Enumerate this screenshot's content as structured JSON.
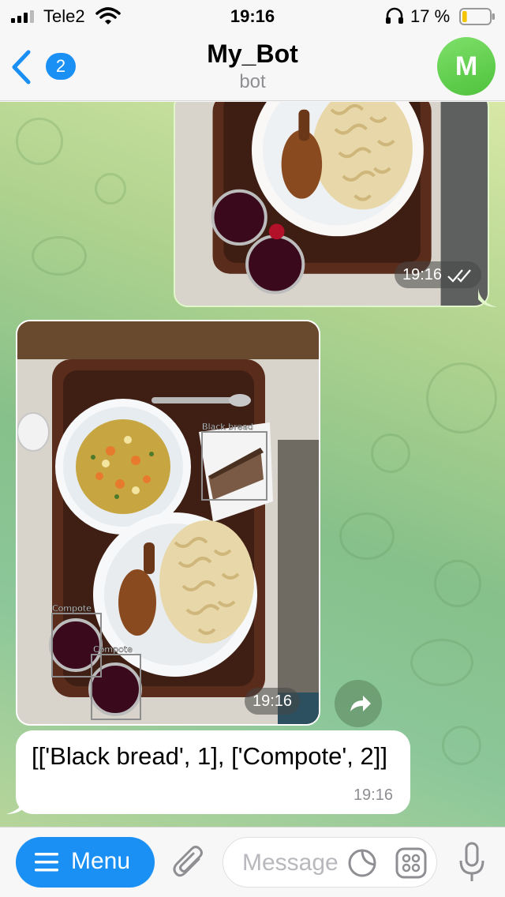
{
  "status_bar": {
    "carrier": "Tele2",
    "time": "19:16",
    "battery_percent": "17 %",
    "battery_level": 0.17,
    "battery_color": "#f5c400",
    "icons": [
      "signal-icon",
      "wifi-icon",
      "headphones-icon",
      "battery-icon"
    ]
  },
  "header": {
    "back_badge": "2",
    "title": "My_Bot",
    "subtitle": "bot",
    "avatar_letter": "M",
    "accent": "#1a8ff4"
  },
  "messages": {
    "outgoing_photo": {
      "time": "19:16",
      "status_icon": "double-check-icon"
    },
    "incoming_photo": {
      "time": "19:16",
      "detections": [
        {
          "label": "Black bread"
        },
        {
          "label": "Compote"
        },
        {
          "label": "Compote"
        }
      ]
    },
    "incoming_text": {
      "text": "[['Black bread', 1], ['Compote', 2]]",
      "time": "19:16"
    }
  },
  "input_bar": {
    "menu_label": "Menu",
    "placeholder": "Message",
    "icons": [
      "menu-icon",
      "paperclip-icon",
      "sticker-icon",
      "apps-icon",
      "microphone-icon"
    ]
  }
}
